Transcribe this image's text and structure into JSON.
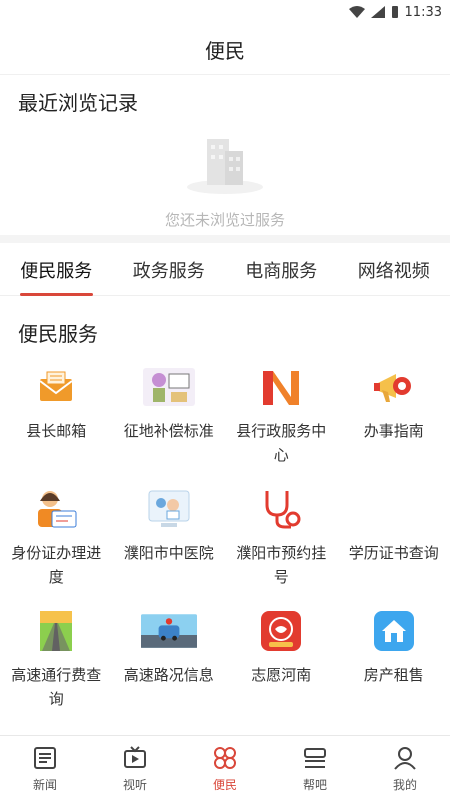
{
  "statusbar": {
    "time": "11:33"
  },
  "header": {
    "title": "便民"
  },
  "recent": {
    "title": "最近浏览记录",
    "empty_text": "您还未浏览过服务"
  },
  "tabs": [
    {
      "label": "便民服务"
    },
    {
      "label": "政务服务"
    },
    {
      "label": "电商服务"
    },
    {
      "label": "网络视频"
    }
  ],
  "services": {
    "title": "便民服务",
    "items": [
      {
        "label": "县长邮箱",
        "icon": "mail-icon"
      },
      {
        "label": "征地补偿标准",
        "icon": "land-compensation-icon"
      },
      {
        "label": "县行政服务中心",
        "icon": "admin-center-icon"
      },
      {
        "label": "办事指南",
        "icon": "megaphone-icon"
      },
      {
        "label": "身份证办理进度",
        "icon": "id-card-icon"
      },
      {
        "label": "濮阳市中医院",
        "icon": "hospital-icon"
      },
      {
        "label": "濮阳市预约挂号",
        "icon": "stethoscope-icon"
      },
      {
        "label": "学历证书查询",
        "icon": "certificate-icon"
      },
      {
        "label": "高速通行费查询",
        "icon": "highway-toll-icon"
      },
      {
        "label": "高速路况信息",
        "icon": "road-condition-icon"
      },
      {
        "label": "志愿河南",
        "icon": "volunteer-icon"
      },
      {
        "label": "房产租售",
        "icon": "house-icon"
      }
    ]
  },
  "bottom_nav": [
    {
      "label": "新闻",
      "icon": "news-icon"
    },
    {
      "label": "视听",
      "icon": "video-icon"
    },
    {
      "label": "便民",
      "icon": "service-icon"
    },
    {
      "label": "帮吧",
      "icon": "help-icon"
    },
    {
      "label": "我的",
      "icon": "profile-icon"
    }
  ],
  "colors": {
    "accent": "#d9473a"
  }
}
